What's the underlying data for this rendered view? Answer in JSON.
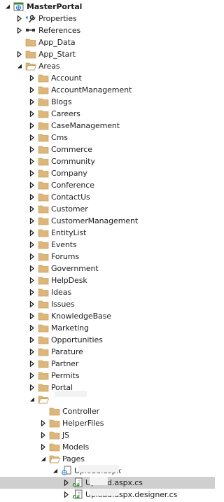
{
  "tree": {
    "items": [
      {
        "label": "MasterPortal",
        "level": 0,
        "chevron": "expanded",
        "icon": "project",
        "bold": true
      },
      {
        "label": "Properties",
        "level": 1,
        "chevron": "collapsed",
        "icon": "properties-wrench"
      },
      {
        "label": "References",
        "level": 1,
        "chevron": "collapsed",
        "icon": "references"
      },
      {
        "label": "App_Data",
        "level": 1,
        "chevron": "none",
        "icon": "folder-closed"
      },
      {
        "label": "App_Start",
        "level": 1,
        "chevron": "collapsed",
        "icon": "folder-closed"
      },
      {
        "label": "Areas",
        "level": 1,
        "chevron": "expanded",
        "icon": "folder-open"
      },
      {
        "label": "Account",
        "level": 2,
        "chevron": "collapsed",
        "icon": "folder-closed"
      },
      {
        "label": "AccountManagement",
        "level": 2,
        "chevron": "collapsed",
        "icon": "folder-closed"
      },
      {
        "label": "Blogs",
        "level": 2,
        "chevron": "collapsed",
        "icon": "folder-closed"
      },
      {
        "label": "Careers",
        "level": 2,
        "chevron": "collapsed",
        "icon": "folder-closed"
      },
      {
        "label": "CaseManagement",
        "level": 2,
        "chevron": "collapsed",
        "icon": "folder-closed"
      },
      {
        "label": "Cms",
        "level": 2,
        "chevron": "collapsed",
        "icon": "folder-closed"
      },
      {
        "label": "Commerce",
        "level": 2,
        "chevron": "collapsed",
        "icon": "folder-closed"
      },
      {
        "label": "Community",
        "level": 2,
        "chevron": "collapsed",
        "icon": "folder-closed"
      },
      {
        "label": "Company",
        "level": 2,
        "chevron": "collapsed",
        "icon": "folder-closed"
      },
      {
        "label": "Conference",
        "level": 2,
        "chevron": "collapsed",
        "icon": "folder-closed"
      },
      {
        "label": "ContactUs",
        "level": 2,
        "chevron": "collapsed",
        "icon": "folder-closed"
      },
      {
        "label": "Customer",
        "level": 2,
        "chevron": "collapsed",
        "icon": "folder-closed"
      },
      {
        "label": "CustomerManagement",
        "level": 2,
        "chevron": "collapsed",
        "icon": "folder-closed"
      },
      {
        "label": "EntityList",
        "level": 2,
        "chevron": "collapsed",
        "icon": "folder-closed"
      },
      {
        "label": "Events",
        "level": 2,
        "chevron": "collapsed",
        "icon": "folder-closed"
      },
      {
        "label": "Forums",
        "level": 2,
        "chevron": "collapsed",
        "icon": "folder-closed"
      },
      {
        "label": "Government",
        "level": 2,
        "chevron": "collapsed",
        "icon": "folder-closed"
      },
      {
        "label": "HelpDesk",
        "level": 2,
        "chevron": "collapsed",
        "icon": "folder-closed"
      },
      {
        "label": "Ideas",
        "level": 2,
        "chevron": "collapsed",
        "icon": "folder-closed"
      },
      {
        "label": "Issues",
        "level": 2,
        "chevron": "collapsed",
        "icon": "folder-closed"
      },
      {
        "label": "KnowledgeBase",
        "level": 2,
        "chevron": "collapsed",
        "icon": "folder-closed"
      },
      {
        "label": "Marketing",
        "level": 2,
        "chevron": "collapsed",
        "icon": "folder-closed"
      },
      {
        "label": "Opportunities",
        "level": 2,
        "chevron": "collapsed",
        "icon": "folder-closed"
      },
      {
        "label": "Parature",
        "level": 2,
        "chevron": "collapsed",
        "icon": "folder-closed"
      },
      {
        "label": "Partner",
        "level": 2,
        "chevron": "collapsed",
        "icon": "folder-closed"
      },
      {
        "label": "Permits",
        "level": 2,
        "chevron": "collapsed",
        "icon": "folder-closed"
      },
      {
        "label": "Portal",
        "level": 2,
        "chevron": "collapsed",
        "icon": "folder-closed"
      },
      {
        "label": "",
        "level": 2,
        "chevron": "expanded",
        "icon": "folder-open"
      },
      {
        "label": "Controller",
        "level": 3,
        "chevron": "none",
        "icon": "folder-closed"
      },
      {
        "label": "HelperFiles",
        "level": 3,
        "chevron": "collapsed",
        "icon": "folder-closed"
      },
      {
        "label": "JS",
        "level": 3,
        "chevron": "collapsed",
        "icon": "folder-closed"
      },
      {
        "label": "Models",
        "level": 3,
        "chevron": "collapsed",
        "icon": "folder-closed"
      },
      {
        "label": "Pages",
        "level": 3,
        "chevron": "expanded",
        "icon": "folder-open"
      },
      {
        "label": "Upload.aspx",
        "level": 4,
        "chevron": "expanded",
        "icon": "aspx-page"
      },
      {
        "label": "Upload.aspx.cs",
        "level": 5,
        "chevron": "collapsed",
        "icon": "cs-file",
        "selected": true
      },
      {
        "label": "Upload.aspx.designer.cs",
        "level": 5,
        "chevron": "collapsed",
        "icon": "cs-file"
      }
    ]
  },
  "colors": {
    "folder": "#dcb67a",
    "folder_dark": "#c9a260",
    "chevron": "#1e1e1e",
    "selection": "#cfcfcf",
    "csharp": "#388a34",
    "vs_blue": "#1f75cc"
  }
}
